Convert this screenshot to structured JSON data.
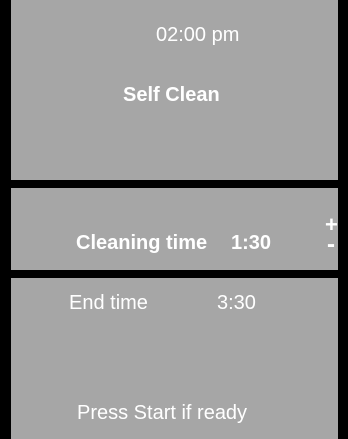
{
  "header": {
    "clock": "02:00 pm",
    "program": "Self Clean"
  },
  "cleaning": {
    "label": "Cleaning time",
    "value": "1:30",
    "increase_label": "+",
    "decrease_label": "-"
  },
  "end_time": {
    "label": "End time",
    "value": "3:30"
  },
  "prompt": "Press Start if ready",
  "colors": {
    "background": "#000000",
    "panel": "#a6a6a6",
    "text": "#ffffff"
  }
}
